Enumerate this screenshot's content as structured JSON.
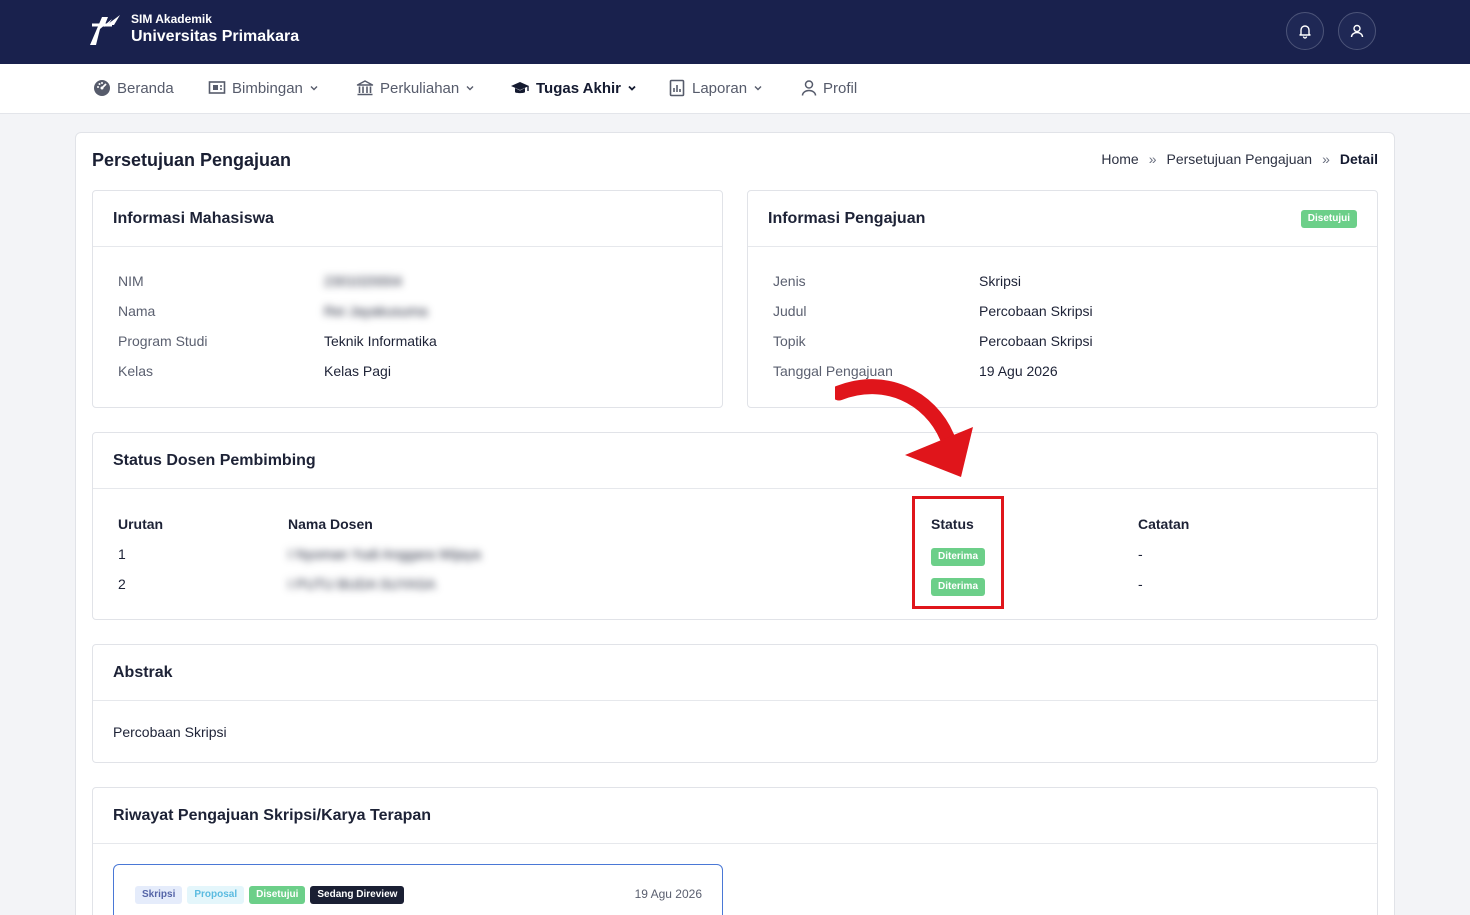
{
  "header": {
    "app_small": "SIM Akademik",
    "app_name": "Universitas Primakara",
    "icons": [
      "logo-icon",
      "bell-icon",
      "user-icon"
    ]
  },
  "nav": {
    "items": [
      {
        "label": "Beranda",
        "icon": "dashboard-icon"
      },
      {
        "label": "Bimbingan",
        "icon": "board-icon"
      },
      {
        "label": "Perkuliahan",
        "icon": "building-icon"
      },
      {
        "label": "Tugas Akhir",
        "icon": "graduation-cap-icon",
        "active": true
      },
      {
        "label": "Laporan",
        "icon": "report-icon"
      },
      {
        "label": "Profil",
        "icon": "user-icon"
      }
    ]
  },
  "page": {
    "title": "Persetujuan Pengajuan",
    "breadcrumb": [
      "Home",
      "Persetujuan Pengajuan",
      "Detail"
    ],
    "breadcrumb_sep": "»"
  },
  "mahasiswa": {
    "title": "Informasi Mahasiswa",
    "fields": [
      {
        "label": "NIM",
        "value": "2301020004"
      },
      {
        "label": "Nama",
        "value": "Rei Jayakusuma"
      },
      {
        "label": "Program Studi",
        "value": "Teknik Informatika"
      },
      {
        "label": "Kelas",
        "value": "Kelas Pagi"
      }
    ]
  },
  "pengajuan": {
    "title": "Informasi Pengajuan",
    "status_badge": "Disetujui",
    "fields": [
      {
        "label": "Jenis",
        "value": "Skripsi"
      },
      {
        "label": "Judul",
        "value": "Percobaan Skripsi"
      },
      {
        "label": "Topik",
        "value": "Percobaan Skripsi"
      },
      {
        "label": "Tanggal Pengajuan",
        "value": "19 Agu 2026"
      }
    ]
  },
  "dosen": {
    "title": "Status Dosen Pembimbing",
    "columns": [
      "Urutan",
      "Nama Dosen",
      "Status",
      "Catatan"
    ],
    "rows": [
      {
        "urutan": "1",
        "nama": "I Nyoman Yudi Anggara Wijaya",
        "status": "Diterima",
        "catatan": "-"
      },
      {
        "urutan": "2",
        "nama": "I PUTU BUDA SUYASA",
        "status": "Diterima",
        "catatan": "-"
      }
    ]
  },
  "abstrak": {
    "title": "Abstrak",
    "text": "Percobaan Skripsi"
  },
  "riwayat": {
    "title": "Riwayat Pengajuan Skripsi/Karya Terapan",
    "badges": [
      "Skripsi",
      "Proposal",
      "Disetujui",
      "Sedang Direview"
    ],
    "date": "19 Agu 2026"
  },
  "colors": {
    "topbar": "#19214d",
    "success": "#6ccf89",
    "highlight": "#e0151b"
  }
}
